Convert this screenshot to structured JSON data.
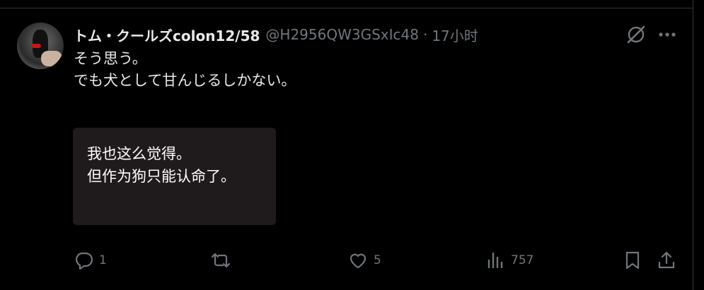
{
  "tweet": {
    "display_name": "トム・クールズcolon12/58",
    "handle": "@H2956QW3GSxIc48",
    "separator": "·",
    "time": "17小时",
    "text_lines": [
      "そう思う。",
      "でも犬として甘んじるしかない。"
    ],
    "translation_lines": [
      "我也这么觉得。",
      "但作为狗只能认命了。"
    ]
  },
  "actions": {
    "reply": {
      "icon": "reply-icon",
      "count": "1"
    },
    "retweet": {
      "icon": "retweet-icon",
      "count": ""
    },
    "like": {
      "icon": "heart-icon",
      "count": "5"
    },
    "views": {
      "icon": "analytics-icon",
      "count": "757"
    },
    "bookmark": {
      "icon": "bookmark-icon"
    },
    "share": {
      "icon": "share-icon"
    }
  },
  "colors": {
    "background": "#000000",
    "text": "#e7e9ea",
    "muted": "#71767b",
    "translation_bg": "#1f1b1c"
  }
}
